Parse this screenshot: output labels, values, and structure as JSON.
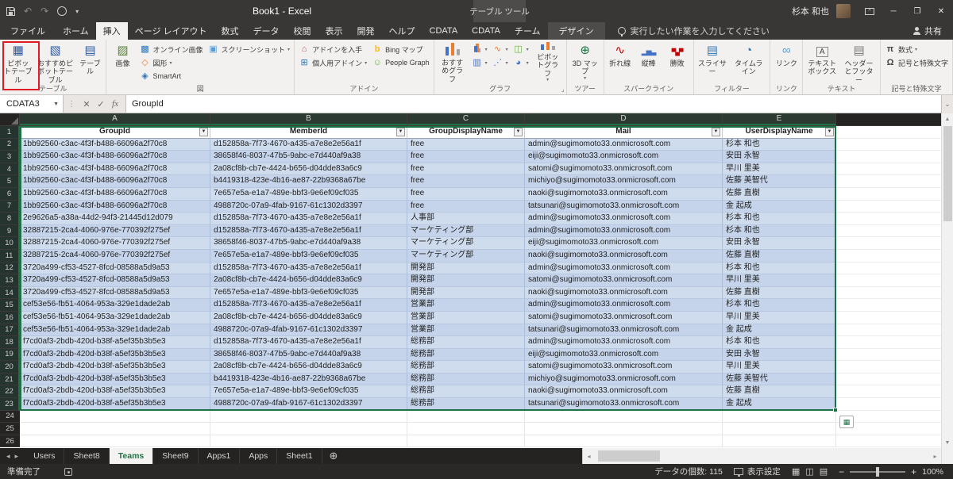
{
  "colors": {
    "accent_green": "#1e7145",
    "selection_fill": "#cfdcee",
    "highlight_red": "#e01b24",
    "titlebar": "#383736",
    "ribbon_bg": "#f3f1f0"
  },
  "title_bar": {
    "title": "Book1 - Excel",
    "context_label": "テーブル ツール",
    "user_name": "杉本 和也"
  },
  "ribbon": {
    "tabs": [
      "ファイル",
      "ホーム",
      "挿入",
      "ページ レイアウト",
      "数式",
      "データ",
      "校閲",
      "表示",
      "開発",
      "ヘルプ",
      "CDATA",
      "CDATA",
      "チーム"
    ],
    "active_tab": "挿入",
    "contextual_tab": "デザイン",
    "search_placeholder": "実行したい作業を入力してください",
    "share_label": "共有",
    "groups": [
      {
        "label": "テーブル",
        "items": [
          {
            "type": "large",
            "name": "pivottable-button",
            "icon": "pivot",
            "label": "ピボットテーブル",
            "highlight": true
          },
          {
            "type": "large",
            "name": "recommended-pivottables-button",
            "icon": "pivot-rec",
            "label": "おすすめピボットテーブル"
          },
          {
            "type": "large",
            "name": "table-button",
            "icon": "table",
            "label": "テーブル"
          }
        ]
      },
      {
        "label": "図",
        "items": [
          {
            "type": "large",
            "name": "pictures-button",
            "icon": "picture",
            "label": "画像"
          },
          {
            "type": "stack",
            "buttons": [
              {
                "name": "online-pictures-button",
                "icon": "online-picture",
                "label": "オンライン画像"
              },
              {
                "name": "shapes-button",
                "icon": "shapes",
                "label": "図形",
                "arrow": true
              },
              {
                "name": "smartart-button",
                "icon": "smartart",
                "label": "SmartArt"
              }
            ]
          },
          {
            "type": "stack",
            "buttons": [
              {
                "name": "screenshot-button",
                "icon": "screenshot",
                "label": "スクリーンショット",
                "arrow": true
              }
            ]
          }
        ]
      },
      {
        "label": "アドイン",
        "items": [
          {
            "type": "stack",
            "buttons": [
              {
                "name": "get-add-ins-button",
                "icon": "store",
                "label": "アドインを入手"
              },
              {
                "name": "my-add-ins-button",
                "icon": "my-addins",
                "label": "個人用アドイン",
                "arrow": true
              }
            ]
          },
          {
            "type": "stack",
            "buttons": [
              {
                "name": "bing-maps-button",
                "icon": "bing",
                "label": "Bing マップ"
              },
              {
                "name": "people-graph-button",
                "icon": "people",
                "label": "People Graph"
              }
            ]
          }
        ]
      },
      {
        "label": "グラフ",
        "dialog": true,
        "items": [
          {
            "type": "large",
            "name": "recommended-charts-button",
            "icon": "chart-rec",
            "label": "おすすめグラフ"
          },
          {
            "type": "stack",
            "buttons": [
              {
                "name": "column-chart-button",
                "icon": "chart-col",
                "label": "",
                "arrow": true
              },
              {
                "name": "hierarchy-chart-button",
                "icon": "chart-hier",
                "label": "",
                "arrow": true
              }
            ]
          },
          {
            "type": "stack",
            "buttons": [
              {
                "name": "line-chart-button",
                "icon": "chart-line",
                "label": "",
                "arrow": true
              },
              {
                "name": "scatter-chart-button",
                "icon": "chart-scatter",
                "label": "",
                "arrow": true
              }
            ]
          },
          {
            "type": "stack",
            "buttons": [
              {
                "name": "combo-chart-button",
                "icon": "chart-combo",
                "label": "",
                "arrow": true
              },
              {
                "name": "pie-chart-button",
                "icon": "chart-pie",
                "label": "",
                "arrow": true
              }
            ]
          },
          {
            "type": "large",
            "name": "pivotchart-button",
            "icon": "pivotchart",
            "label": "ピボットグラフ",
            "arrow": true
          }
        ]
      },
      {
        "label": "ツアー",
        "items": [
          {
            "type": "large",
            "name": "3d-map-button",
            "icon": "map3d",
            "label": "3D マップ",
            "arrow": true
          }
        ]
      },
      {
        "label": "スパークライン",
        "items": [
          {
            "type": "large",
            "name": "line-sparkline-button",
            "icon": "spark-line",
            "label": "折れ線"
          },
          {
            "type": "large",
            "name": "column-sparkline-button",
            "icon": "spark-col",
            "label": "縦棒"
          },
          {
            "type": "large",
            "name": "winloss-sparkline-button",
            "icon": "spark-winloss",
            "label": "勝敗"
          }
        ]
      },
      {
        "label": "フィルター",
        "items": [
          {
            "type": "large",
            "name": "slicer-button",
            "icon": "slicer",
            "label": "スライサー"
          },
          {
            "type": "large",
            "name": "timeline-button",
            "icon": "timeline",
            "label": "タイムライン"
          }
        ]
      },
      {
        "label": "リンク",
        "items": [
          {
            "type": "large",
            "name": "link-button",
            "icon": "link",
            "label": "リンク"
          }
        ]
      },
      {
        "label": "テキスト",
        "items": [
          {
            "type": "large",
            "name": "text-box-button",
            "icon": "textbox",
            "label": "テキストボックス"
          },
          {
            "type": "large",
            "name": "header-footer-button",
            "icon": "headerfooter",
            "label": "ヘッダーとフッター"
          }
        ]
      },
      {
        "label": "記号と特殊文字",
        "items": [
          {
            "type": "stack",
            "buttons": [
              {
                "name": "equation-button",
                "icon": "equation",
                "label": "数式",
                "arrow": true
              },
              {
                "name": "symbol-button",
                "icon": "symbol",
                "label": "記号と特殊文字"
              }
            ]
          }
        ]
      }
    ]
  },
  "formula_bar": {
    "name_box": "CDATA3",
    "formula": "GroupId"
  },
  "sheet": {
    "columns": [
      "A",
      "B",
      "C",
      "D",
      "E"
    ],
    "header_row": [
      "GroupId",
      "MemberId",
      "GroupDisplayName",
      "Mail",
      "UserDisplayName"
    ],
    "data_rows": [
      [
        "1bb92560-c3ac-4f3f-b488-66096a2f70c8",
        "d152858a-7f73-4670-a435-a7e8e2e56a1f",
        "free",
        "admin@sugimomoto33.onmicrosoft.com",
        "杉本 和也"
      ],
      [
        "1bb92560-c3ac-4f3f-b488-66096a2f70c8",
        "38658f46-8037-47b5-9abc-e7d440af9a38",
        "free",
        "eiji@sugimomoto33.onmicrosoft.com",
        "安田 永智"
      ],
      [
        "1bb92560-c3ac-4f3f-b488-66096a2f70c8",
        "2a08cf8b-cb7e-4424-b656-d04dde83a6c9",
        "free",
        "satomi@sugimomoto33.onmicrosoft.com",
        "早川 里美"
      ],
      [
        "1bb92560-c3ac-4f3f-b488-66096a2f70c8",
        "b4419318-423e-4b16-ae87-22b9368a67be",
        "free",
        "michiyo@sugimomoto33.onmicrosoft.com",
        "佐藤 美智代"
      ],
      [
        "1bb92560-c3ac-4f3f-b488-66096a2f70c8",
        "7e657e5a-e1a7-489e-bbf3-9e6ef09cf035",
        "free",
        "naoki@sugimomoto33.onmicrosoft.com",
        "佐藤 直樹"
      ],
      [
        "1bb92560-c3ac-4f3f-b488-66096a2f70c8",
        "4988720c-07a9-4fab-9167-61c1302d3397",
        "free",
        "tatsunari@sugimomoto33.onmicrosoft.com",
        "金 起成"
      ],
      [
        "2e9626a5-a38a-44d2-94f3-21445d12d079",
        "d152858a-7f73-4670-a435-a7e8e2e56a1f",
        "人事部",
        "admin@sugimomoto33.onmicrosoft.com",
        "杉本 和也"
      ],
      [
        "32887215-2ca4-4060-976e-770392f275ef",
        "d152858a-7f73-4670-a435-a7e8e2e56a1f",
        "マーケティング部",
        "admin@sugimomoto33.onmicrosoft.com",
        "杉本 和也"
      ],
      [
        "32887215-2ca4-4060-976e-770392f275ef",
        "38658f46-8037-47b5-9abc-e7d440af9a38",
        "マーケティング部",
        "eiji@sugimomoto33.onmicrosoft.com",
        "安田 永智"
      ],
      [
        "32887215-2ca4-4060-976e-770392f275ef",
        "7e657e5a-e1a7-489e-bbf3-9e6ef09cf035",
        "マーケティング部",
        "naoki@sugimomoto33.onmicrosoft.com",
        "佐藤 直樹"
      ],
      [
        "3720a499-cf53-4527-8fcd-08588a5d9a53",
        "d152858a-7f73-4670-a435-a7e8e2e56a1f",
        "開発部",
        "admin@sugimomoto33.onmicrosoft.com",
        "杉本 和也"
      ],
      [
        "3720a499-cf53-4527-8fcd-08588a5d9a53",
        "2a08cf8b-cb7e-4424-b656-d04dde83a6c9",
        "開発部",
        "satomi@sugimomoto33.onmicrosoft.com",
        "早川 里美"
      ],
      [
        "3720a499-cf53-4527-8fcd-08588a5d9a53",
        "7e657e5a-e1a7-489e-bbf3-9e6ef09cf035",
        "開発部",
        "naoki@sugimomoto33.onmicrosoft.com",
        "佐藤 直樹"
      ],
      [
        "cef53e56-fb51-4064-953a-329e1dade2ab",
        "d152858a-7f73-4670-a435-a7e8e2e56a1f",
        "営業部",
        "admin@sugimomoto33.onmicrosoft.com",
        "杉本 和也"
      ],
      [
        "cef53e56-fb51-4064-953a-329e1dade2ab",
        "2a08cf8b-cb7e-4424-b656-d04dde83a6c9",
        "営業部",
        "satomi@sugimomoto33.onmicrosoft.com",
        "早川 里美"
      ],
      [
        "cef53e56-fb51-4064-953a-329e1dade2ab",
        "4988720c-07a9-4fab-9167-61c1302d3397",
        "営業部",
        "tatsunari@sugimomoto33.onmicrosoft.com",
        "金 起成"
      ],
      [
        "f7cd0af3-2bdb-420d-b38f-a5ef35b3b5e3",
        "d152858a-7f73-4670-a435-a7e8e2e56a1f",
        "総務部",
        "admin@sugimomoto33.onmicrosoft.com",
        "杉本 和也"
      ],
      [
        "f7cd0af3-2bdb-420d-b38f-a5ef35b3b5e3",
        "38658f46-8037-47b5-9abc-e7d440af9a38",
        "総務部",
        "eiji@sugimomoto33.onmicrosoft.com",
        "安田 永智"
      ],
      [
        "f7cd0af3-2bdb-420d-b38f-a5ef35b3b5e3",
        "2a08cf8b-cb7e-4424-b656-d04dde83a6c9",
        "総務部",
        "satomi@sugimomoto33.onmicrosoft.com",
        "早川 里美"
      ],
      [
        "f7cd0af3-2bdb-420d-b38f-a5ef35b3b5e3",
        "b4419318-423e-4b16-ae87-22b9368a67be",
        "総務部",
        "michiyo@sugimomoto33.onmicrosoft.com",
        "佐藤 美智代"
      ],
      [
        "f7cd0af3-2bdb-420d-b38f-a5ef35b3b5e3",
        "7e657e5a-e1a7-489e-bbf3-9e6ef09cf035",
        "総務部",
        "naoki@sugimomoto33.onmicrosoft.com",
        "佐藤 直樹"
      ],
      [
        "f7cd0af3-2bdb-420d-b38f-a5ef35b3b5e3",
        "4988720c-07a9-4fab-9167-61c1302d3397",
        "総務部",
        "tatsunari@sugimomoto33.onmicrosoft.com",
        "金 起成"
      ]
    ],
    "last_visible_row": 26
  },
  "sheet_tabs": {
    "tabs": [
      "Users",
      "Sheet8",
      "Teams",
      "Sheet9",
      "Apps1",
      "Apps",
      "Sheet1"
    ],
    "active": "Teams"
  },
  "status_bar": {
    "ready": "準備完了",
    "data_count": "データの個数: 115",
    "display_settings": "表示設定",
    "zoom": "100%"
  }
}
